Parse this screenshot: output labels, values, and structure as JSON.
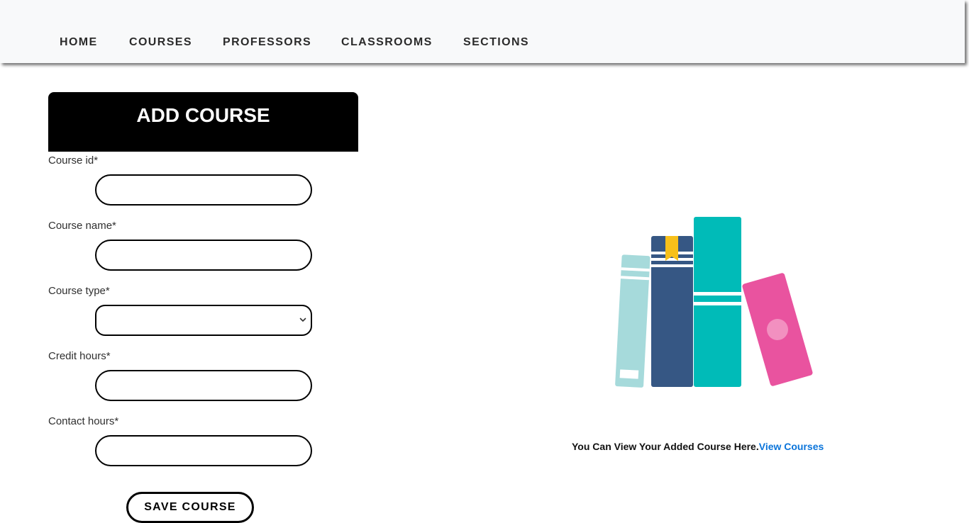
{
  "nav": {
    "items": [
      {
        "label": "HOME"
      },
      {
        "label": "COURSES"
      },
      {
        "label": "PROFESSORS"
      },
      {
        "label": "CLASSROOMS"
      },
      {
        "label": "SECTIONS"
      }
    ]
  },
  "form": {
    "title": "ADD COURSE",
    "fields": [
      {
        "label": "Course id*",
        "value": "",
        "placeholder": ""
      },
      {
        "label": "Course name*",
        "value": "",
        "placeholder": ""
      },
      {
        "label": "Course type*",
        "selected": ""
      },
      {
        "label": "Credit hours*",
        "value": "",
        "placeholder": ""
      },
      {
        "label": "Contact hours*",
        "value": "",
        "placeholder": ""
      }
    ],
    "save_label": "SAVE COURSE"
  },
  "view": {
    "text": "You Can View Your Added Course Here.",
    "link_label": "View Courses"
  },
  "illustration": {
    "icon": "books-icon",
    "colors": {
      "light_teal": "#a6dadb",
      "navy": "#365784",
      "teal": "#00bbb8",
      "pink": "#e9539f",
      "bookmark": "#f7c01a"
    }
  }
}
